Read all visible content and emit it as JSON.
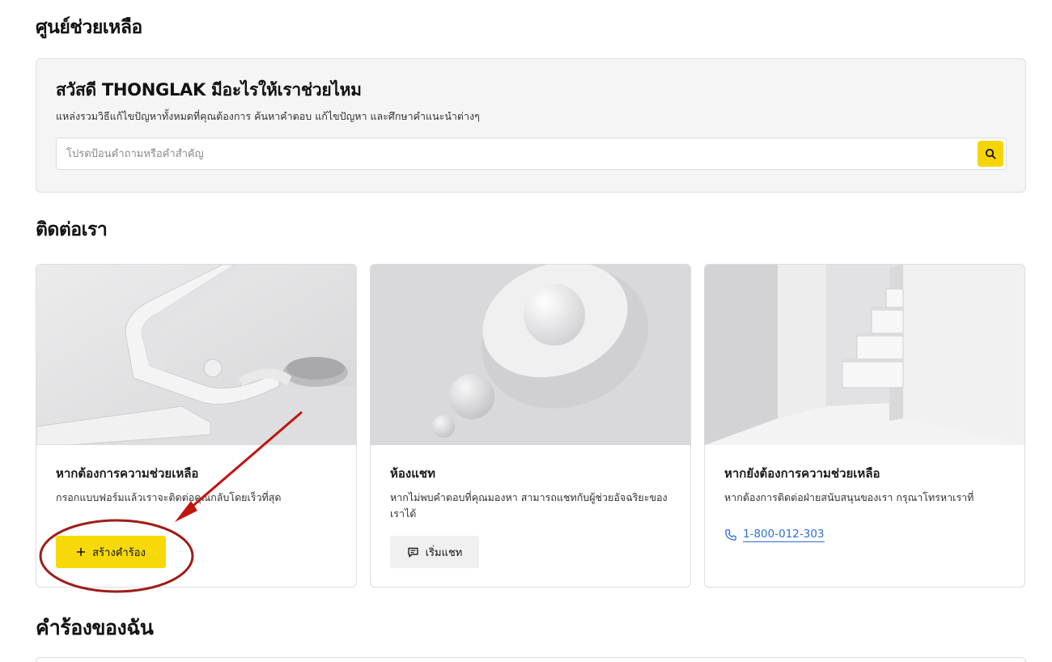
{
  "help_center": {
    "title": "ศูนย์ช่วยเหลือ",
    "greeting": "สวัสดี THONGLAK มีอะไรให้เราช่วยไหม",
    "subtitle": "แหล่งรวมวิธีแก้ไขปัญหาทั้งหมดที่คุณต้องการ ค้นหาคำตอบ แก้ไขปัญหา และศึกษาคำแนะนำต่างๆ",
    "search_placeholder": "โปรดป้อนคำถามหรือคำสำคัญ",
    "search_icon": "search-icon"
  },
  "contact": {
    "title": "ติดต่อเรา",
    "cards": [
      {
        "title": "หากต้องการความช่วยเหลือ",
        "description": "กรอกแบบฟอร์มแล้วเราจะติดต่อคุณกลับโดยเร็วที่สุด",
        "button_label": "สร้างคำร้อง",
        "button_icon": "plus-icon"
      },
      {
        "title": "ห้องแชท",
        "description": "หากไม่พบคำตอบที่คุณมองหา สามารถแชทกับผู้ช่วยอัจฉริยะของเราได้",
        "button_label": "เริ่มแชท",
        "button_icon": "chat-icon"
      },
      {
        "title": "หากยังต้องการความช่วยเหลือ",
        "description": "หากต้องการติดต่อฝ่ายสนับสนุนของเรา กรุณาโทรหาเราที่",
        "phone": "1-800-012-303",
        "phone_icon": "phone-icon"
      }
    ]
  },
  "my_requests": {
    "title": "คำร้องของฉัน"
  },
  "colors": {
    "accent": "#f7d90a",
    "link": "#2f6fd6",
    "annotation": "#c0140f"
  }
}
